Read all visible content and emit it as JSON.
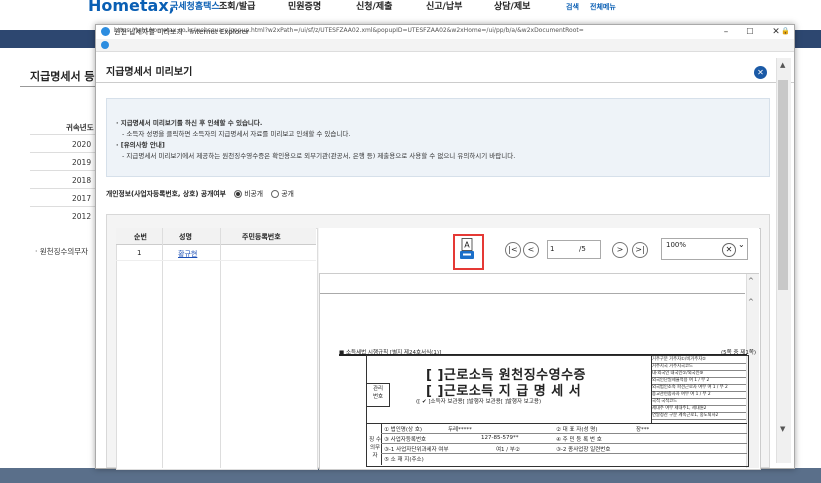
{
  "site": {
    "logo": "Hometax,",
    "logo_sub": "국세청홈택스",
    "nav": [
      "조회/발급",
      "민원증명",
      "신청/제출",
      "신고/납부",
      "상담/제보"
    ],
    "search": "검색",
    "all_menu": "전체메뉴"
  },
  "background": {
    "page_title": "지급명세서 등",
    "year_header": "귀속년도",
    "years": [
      "2020",
      "2019",
      "2018",
      "2017",
      "2012"
    ],
    "note": "· 원천징수의무자"
  },
  "ie": {
    "title": "원천 납세자별 미리보기 - Internet Explorer",
    "url": "https://teht.hometax.go.kr/websquare/popup.html?w2xPath=/ui/sf/z/UTESFZAA02.xml&popupID=UTESFZAA02&w2xHome=/ui/pp/b/a/&w2xDocumentRoot=",
    "minimize": "–",
    "maximize": "☐",
    "close": "✕"
  },
  "popup": {
    "title": "지급명세서 미리보기",
    "info": {
      "line1": "· 지급명세서 미리보기를 하신 후 인쇄할 수 있습니다.",
      "line2": "- 소득자 성명을 클릭하면 소득자의 지급명세서 자료를 미리보고 인쇄할 수 있습니다.",
      "line3": "· [유의사항 안내]",
      "line4": "- 지급명세서 미리보기에서 제공하는 원천징수영수증은 확인용으로 외부기관(관공서, 은행 등) 제출용으로 사용할 수 없으니 유의하시기 바랍니다."
    },
    "privacy": {
      "label": "개인정보(사업자등록번호, 상호) 공개여부",
      "option_private": "비공개",
      "option_public": "공개",
      "selected": "비공개"
    },
    "list": {
      "headers": [
        "순번",
        "성명",
        "주민등록번호"
      ],
      "rows": [
        {
          "no": "1",
          "name": "황규현",
          "rrn": ""
        }
      ]
    },
    "viewer": {
      "print_letter": "A",
      "first": "|<",
      "prev": "<",
      "page": "1",
      "total": "/5",
      "next": ">",
      "last": ">|",
      "zoom": "100%"
    },
    "doc": {
      "caption_left": "■ 소득세법 시행규칙 [별지 제24호서식(1)]",
      "caption_right": "(5쪽 중 제1쪽)",
      "manage_no": "관리\n번호",
      "title1": "[    ]근로소득  원천징수영수증",
      "title2": "[    ]근로소득  지 급 명 세 서",
      "subtitle": "([ ✔ ]소득자 보관용[      ]발행자 보관용[      ]발행자 보고용)",
      "right_rows": [
        "거주구분     거주자①/비거주자②",
        "거주지국      거주지국코드",
        "내·외국인     내국인①/외국인⑨",
        "외국인단일세율적용     여 1 / 부 2",
        "외국법인소속 파견근로자 여부   여 1 / 부 2",
        "종교관련종사자 여부     여 1 / 부 2",
        "국적       국적코드",
        "세대주 여부     세대주1, 세대원2",
        "연말정산 구분   계속근로1, 중도퇴사2"
      ],
      "payer_label": "징 수\n의무자",
      "row1_a": "① 법인명(상  호)",
      "row1_b": "두레*****",
      "row1_c": "② 대 표 자(성  명)",
      "row1_d": "장***",
      "row2_a": "③ 사업자등록번호",
      "row2_b": "127-85-579**",
      "row2_c": "④ 주 민 등 록 번 호",
      "row3_a": "③-1 사업자단위과세자 여부",
      "row3_b": "여1 / 부②",
      "row3_c": "③-2 종사업장 일련번호",
      "row4_a": "⑤ 소 재 지(주소)"
    }
  }
}
